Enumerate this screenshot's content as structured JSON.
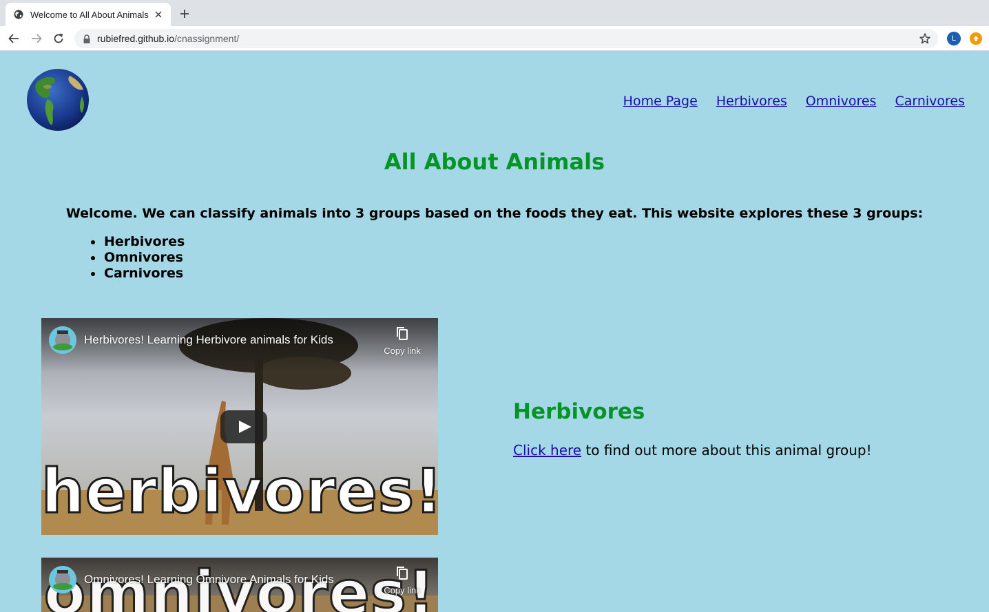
{
  "browser": {
    "tab_title": "Welcome to All About Animals",
    "url_host": "rubiefred.github.io",
    "url_path": "/cnassignment/",
    "profile_initial": "L"
  },
  "nav": {
    "items": [
      "Home Page",
      "Herbivores",
      "Omnivores",
      "Carnivores"
    ]
  },
  "header": {
    "title": "All About Animals"
  },
  "intro": {
    "text": "Welcome. We can classify animals into 3 groups based on the foods they eat. This website explores these 3 groups:",
    "groups": [
      "Herbivores",
      "Omnivores",
      "Carnivores"
    ]
  },
  "videos": [
    {
      "title": "Herbivores! Learning Herbivore animals for Kids",
      "copy_label": "Copy link",
      "thumbnail_word": "herbivores!"
    },
    {
      "title": "Omnivores! Learning Omnivore Animals for Kids",
      "copy_label": "Copy link",
      "thumbnail_word": "omnivores!"
    }
  ],
  "section": {
    "heading": "Herbivores",
    "link_text": "Click here",
    "rest_text": " to find out more about this animal group!"
  },
  "colors": {
    "page_bg": "#a5d8e6",
    "heading_green": "#079426",
    "link_blue": "#1a0dab"
  }
}
